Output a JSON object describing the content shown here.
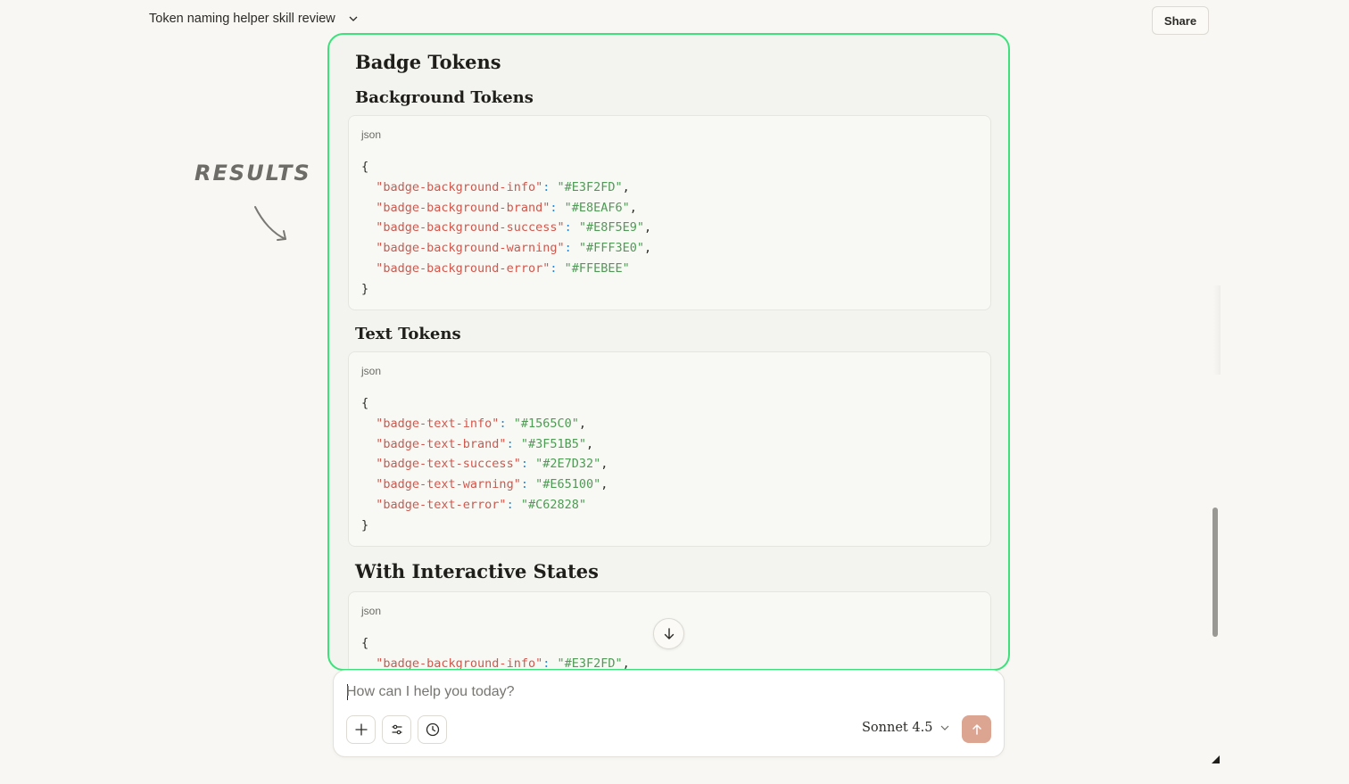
{
  "header": {
    "conversation_title": "Token naming helper skill review",
    "share_label": "Share"
  },
  "annotation": {
    "note_text": "RESULTS"
  },
  "sections": [
    {
      "heading": "Badge Tokens"
    },
    {
      "heading": "Background Tokens",
      "code_language": "json",
      "code": {
        "open": "{",
        "entries": [
          {
            "key": "\"badge-background-info\"",
            "value": "\"#E3F2FD\"",
            "sep": ","
          },
          {
            "key": "\"badge-background-brand\"",
            "value": "\"#E8EAF6\"",
            "sep": ","
          },
          {
            "key": "\"badge-background-success\"",
            "value": "\"#E8F5E9\"",
            "sep": ","
          },
          {
            "key": "\"badge-background-warning\"",
            "value": "\"#FFF3E0\"",
            "sep": ","
          },
          {
            "key": "\"badge-background-error\"",
            "value": "\"#FFEBEE\"",
            "sep": ""
          }
        ],
        "close": "}"
      }
    },
    {
      "heading": "Text Tokens",
      "code_language": "json",
      "code": {
        "open": "{",
        "entries": [
          {
            "key": "\"badge-text-info\"",
            "value": "\"#1565C0\"",
            "sep": ","
          },
          {
            "key": "\"badge-text-brand\"",
            "value": "\"#3F51B5\"",
            "sep": ","
          },
          {
            "key": "\"badge-text-success\"",
            "value": "\"#2E7D32\"",
            "sep": ","
          },
          {
            "key": "\"badge-text-warning\"",
            "value": "\"#E65100\"",
            "sep": ","
          },
          {
            "key": "\"badge-text-error\"",
            "value": "\"#C62828\"",
            "sep": ""
          }
        ],
        "close": "}"
      }
    },
    {
      "heading": "With Interactive States",
      "code_language": "json",
      "code": {
        "open": "{",
        "entries": [
          {
            "key": "\"badge-background-info\"",
            "value": "\"#E3F2FD\"",
            "sep": ","
          }
        ],
        "close": ""
      }
    }
  ],
  "composer": {
    "placeholder": "How can I help you today?",
    "model_label": "Sonnet 4.5"
  },
  "icons": {
    "title_chevron": "chevron-down-icon",
    "scroll_down": "arrow-down-icon",
    "add": "plus-icon",
    "tools": "sliders-icon",
    "history": "clock-icon",
    "model_chevron": "chevron-down-icon",
    "send": "arrow-up-icon"
  },
  "colors": {
    "highlight_border": "#3ee07c",
    "json_key": "#d0574c",
    "json_value": "#4f9a55",
    "json_colon": "#2b8ad8",
    "send_button": "#dba592"
  }
}
